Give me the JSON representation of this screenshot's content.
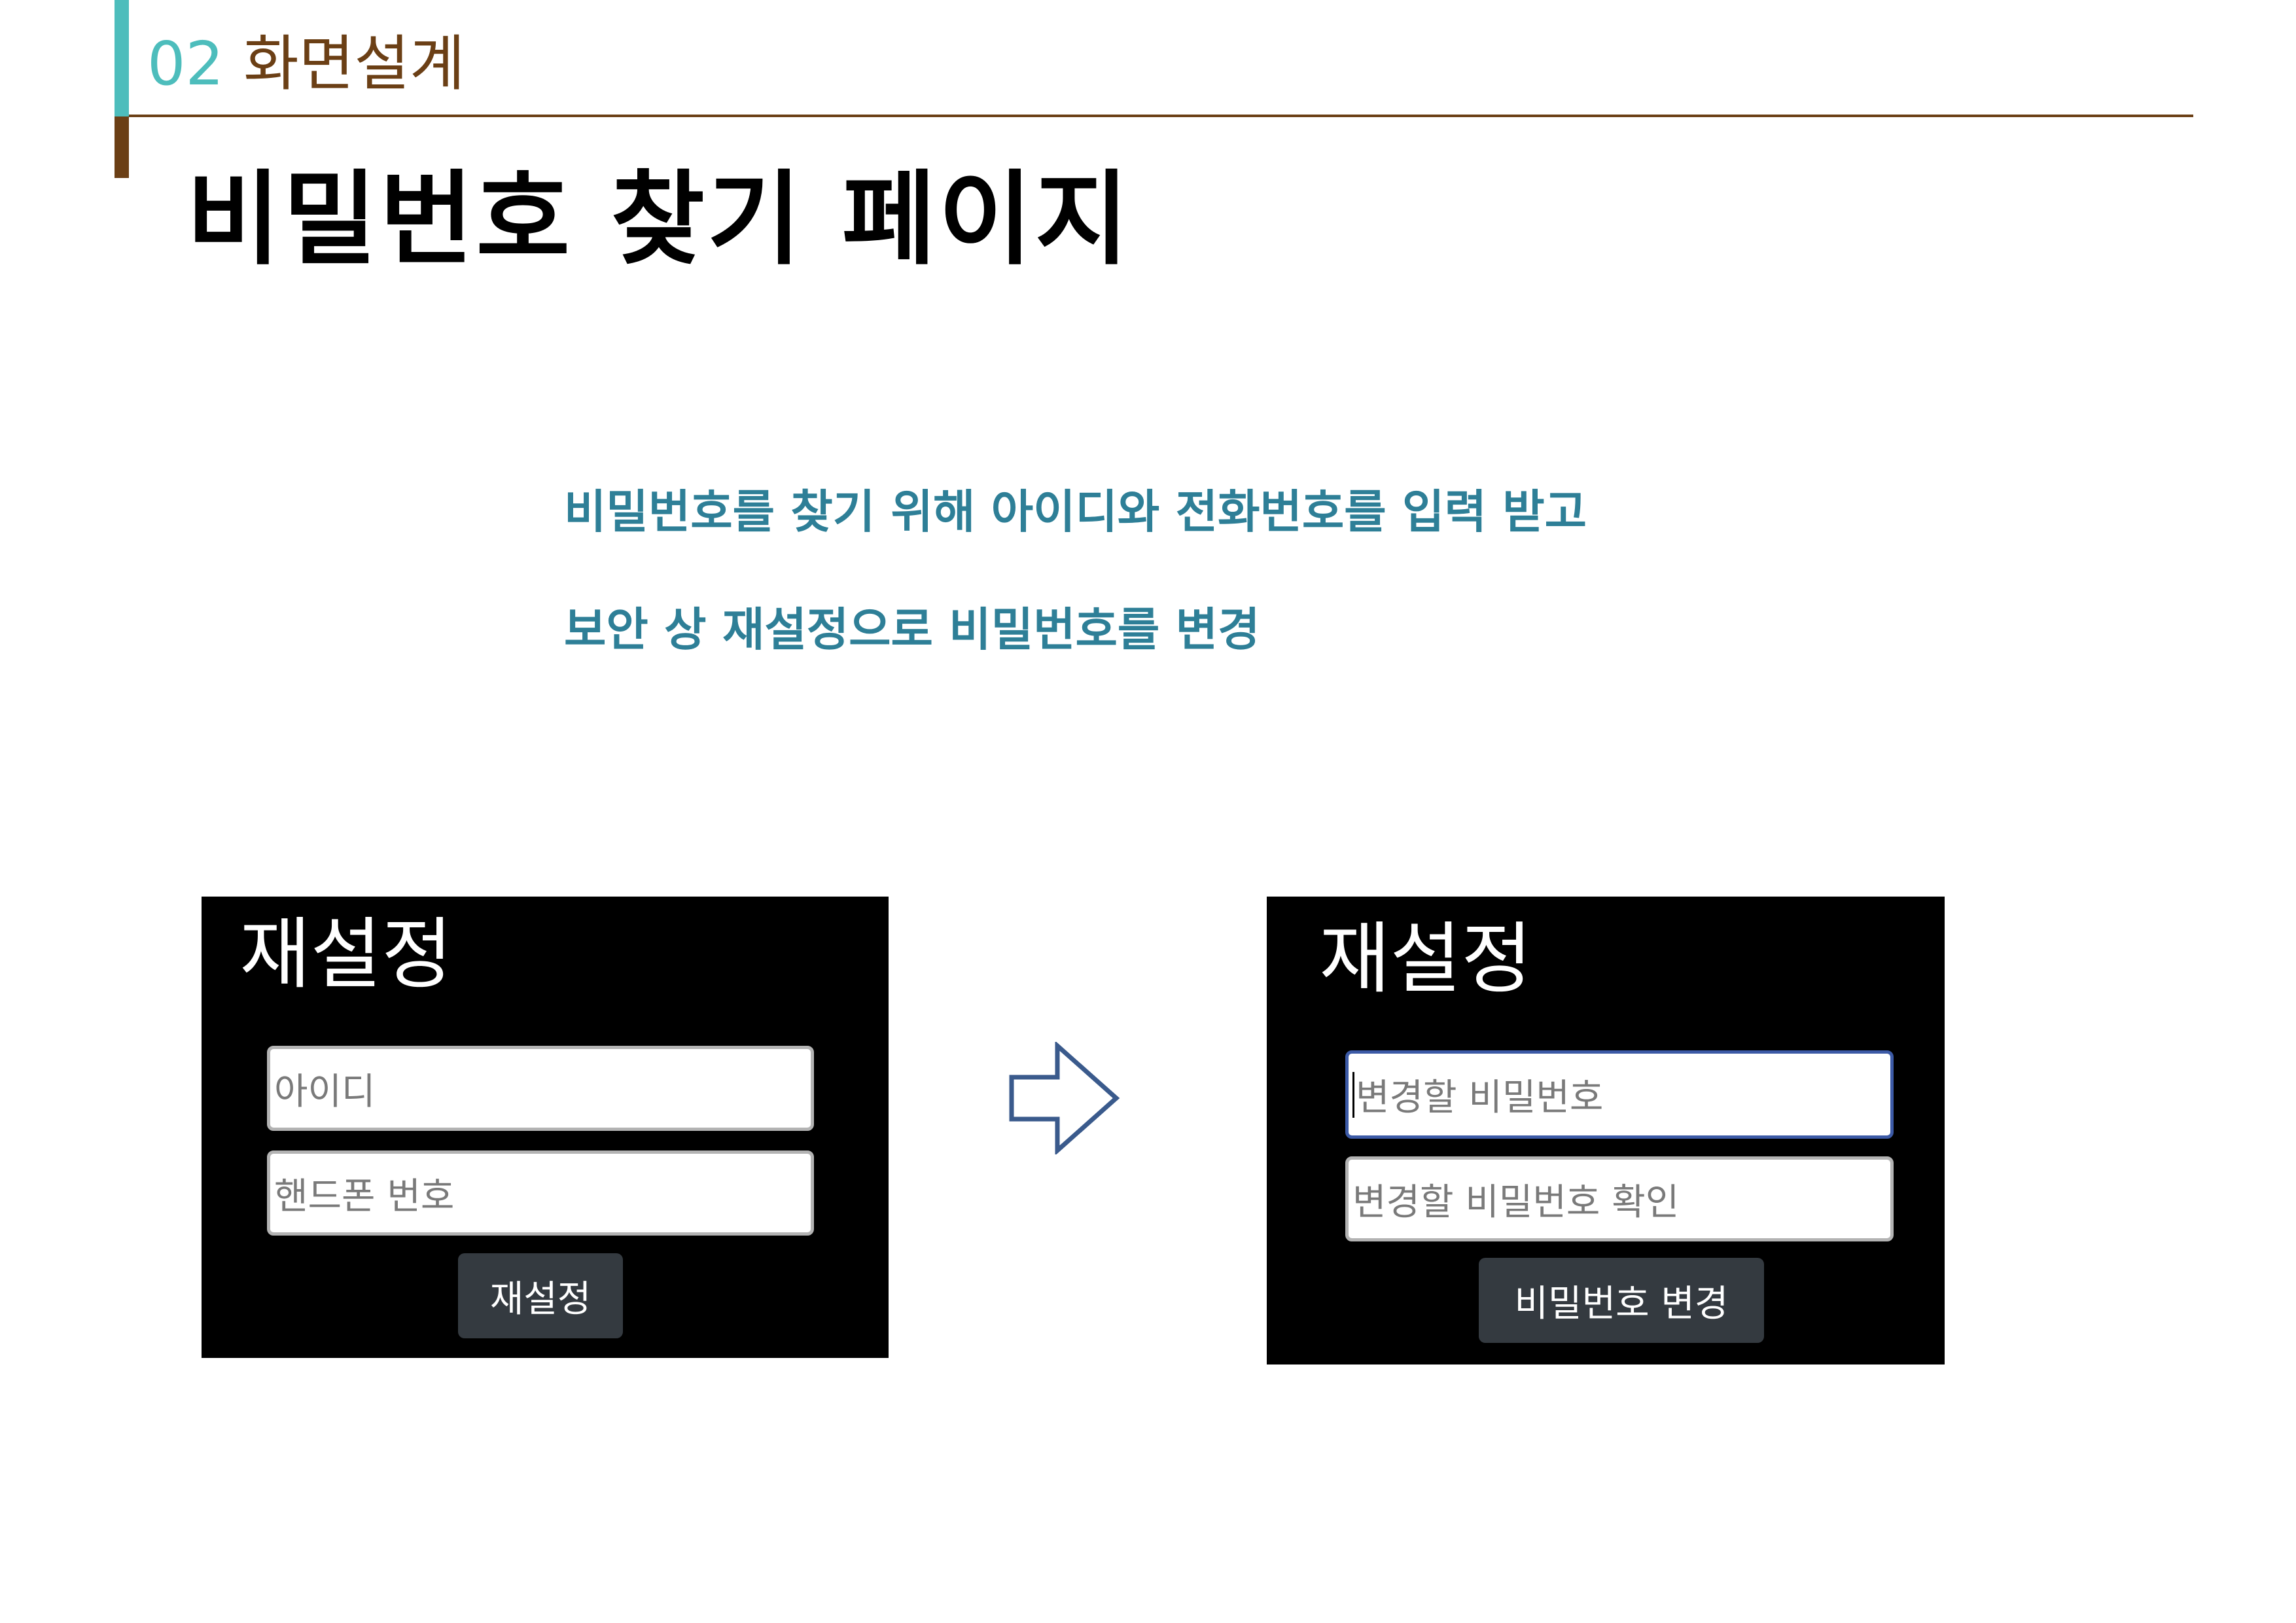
{
  "header": {
    "section_number": "02",
    "section_name": "화면설계",
    "title": "비밀번호 찾기 페이지"
  },
  "description": {
    "line1": "비밀번호를 찾기 위해 아이디와 전화번호를 입력 받고",
    "line2": "보안 상 재설정으로 비밀번호를 변경"
  },
  "left_panel": {
    "title": "재설정",
    "id_placeholder": "아이디",
    "phone_placeholder": "핸드폰 번호",
    "submit_label": "재설정"
  },
  "right_panel": {
    "title": "재설정",
    "new_password_placeholder": "변경할 비밀번호",
    "confirm_password_placeholder": "변경할 비밀번호 확인",
    "submit_label": "비밀번호 변경"
  },
  "colors": {
    "accent_teal": "#4dbdbc",
    "accent_brown": "#6b3f15",
    "description_text": "#2e7f97",
    "panel_background": "#000000",
    "button_background": "#343a40",
    "arrow_stroke": "#3a5a8c"
  },
  "icons": {
    "transition_arrow": "right-arrow-outline-icon"
  }
}
